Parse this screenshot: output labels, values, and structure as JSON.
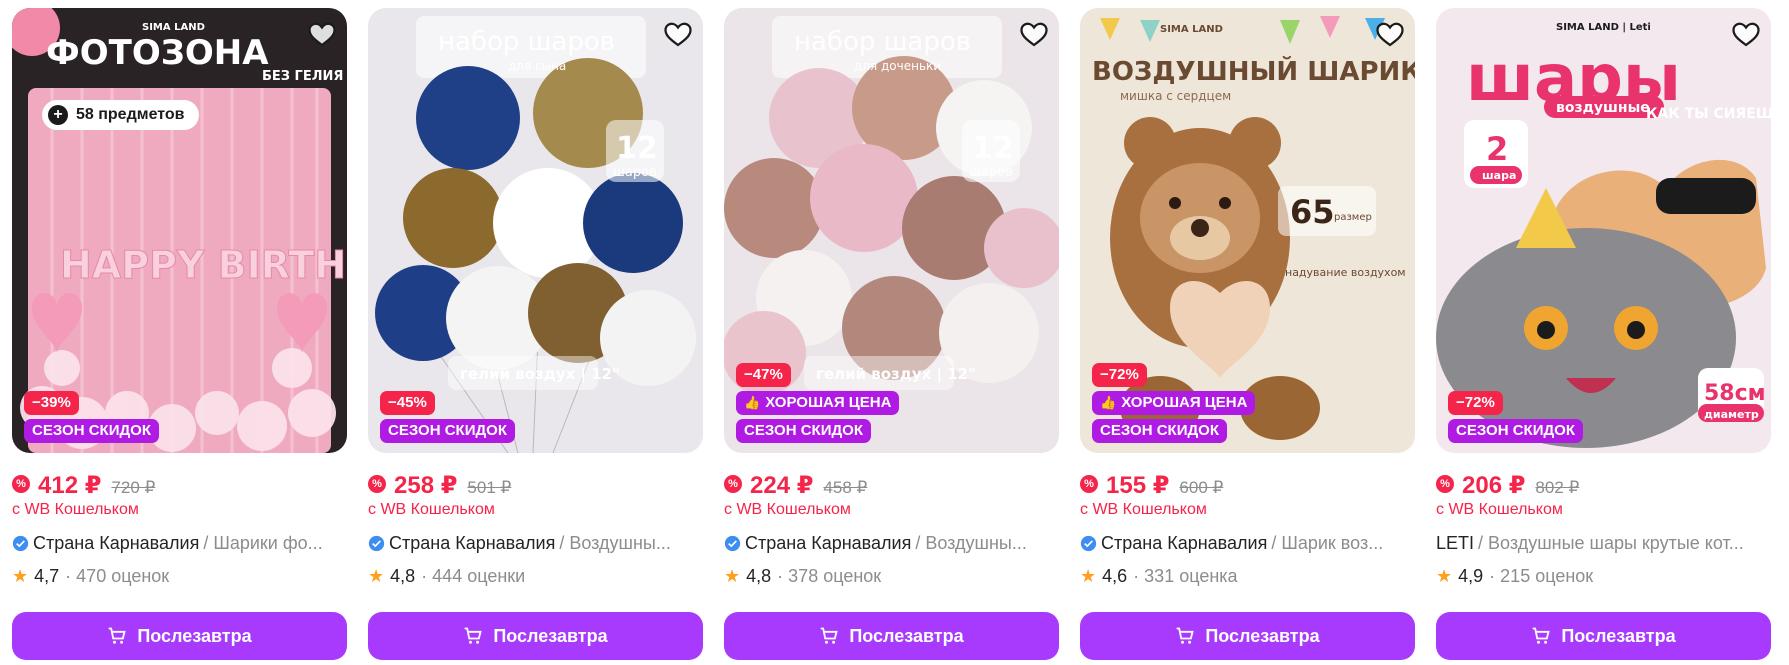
{
  "cards": [
    {
      "headline": "ФОТОЗОНА",
      "subheadline": "БЕЗ ГЕЛИЯ",
      "art_text": "HAPPY BIRTHDAY",
      "logo_text": "SIMA LAND",
      "items_count": "58 предметов",
      "discount": "−39%",
      "promo": "",
      "season": "СЕЗОН СКИДОК",
      "price": "412 ₽",
      "old_price": "720 ₽",
      "wallet": "с WB Кошельком",
      "brand": "Страна Карнавалия",
      "title": " / Шарики фо...",
      "verified": true,
      "rating": "4,7",
      "reviews": "· 470 оценок",
      "button": "Послезавтра",
      "bg": "#f3b6c8"
    },
    {
      "headline": "набор шаров",
      "subheadline": "для сына",
      "art_number": "12",
      "art_unit": "шаров",
      "art_note": "гелий воздух | 12\"",
      "discount": "−45%",
      "promo": "",
      "season": "СЕЗОН СКИДОК",
      "price": "258 ₽",
      "old_price": "501 ₽",
      "wallet": "с WB Кошельком",
      "brand": "Страна Карнавалия",
      "title": " / Воздушны...",
      "verified": true,
      "rating": "4,8",
      "reviews": "· 444 оценки",
      "button": "Послезавтра",
      "bg": "#e8e6ea"
    },
    {
      "headline": "набор шаров",
      "subheadline": "для доченьки",
      "art_number": "12",
      "art_unit": "шаров",
      "art_note": "гелий воздух | 12\"",
      "discount": "−47%",
      "promo": "ХОРОШАЯ ЦЕНА",
      "season": "СЕЗОН СКИДОК",
      "price": "224 ₽",
      "old_price": "458 ₽",
      "wallet": "с WB Кошельком",
      "brand": "Страна Карнавалия",
      "title": " / Воздушны...",
      "verified": true,
      "rating": "4,8",
      "reviews": "· 378 оценок",
      "button": "Послезавтра",
      "bg": "#ece4e8"
    },
    {
      "headline": "ВОЗДУШНЫЙ ШАРИК",
      "subheadline": "мишка с сердцем",
      "art_number": "65",
      "art_unit": "размер",
      "art_note": "надувание воздухом",
      "logo_text": "SIMA LAND",
      "discount": "−72%",
      "promo": "ХОРОШАЯ ЦЕНА",
      "season": "СЕЗОН СКИДОК",
      "price": "155 ₽",
      "old_price": "600 ₽",
      "wallet": "с WB Кошельком",
      "brand": "Страна Карнавалия",
      "title": " / Шарик воз...",
      "verified": true,
      "rating": "4,6",
      "reviews": "· 331 оценка",
      "button": "Послезавтра",
      "bg": "#efe7dc"
    },
    {
      "headline": "шары",
      "subheadline": "воздушные",
      "art_number": "2",
      "art_unit": "шара",
      "art_note": "58см",
      "art_note2": "диаметр",
      "art_bubble": "КАК ТЫ СИЯЕШЬ",
      "logo_text": "SIMA LAND | Leti",
      "discount": "−72%",
      "promo": "",
      "season": "СЕЗОН СКИДОК",
      "price": "206 ₽",
      "old_price": "802 ₽",
      "wallet": "с WB Кошельком",
      "brand": "LETI",
      "title": " / Воздушные шары крутые кот...",
      "verified": false,
      "rating": "4,9",
      "reviews": "· 215 оценок",
      "button": "Послезавтра",
      "bg": "#f2e9ee"
    }
  ],
  "colors": {
    "accent": "#a73afd",
    "price": "#f5244a",
    "season": "#b01be3",
    "star": "#ff9f1c"
  }
}
